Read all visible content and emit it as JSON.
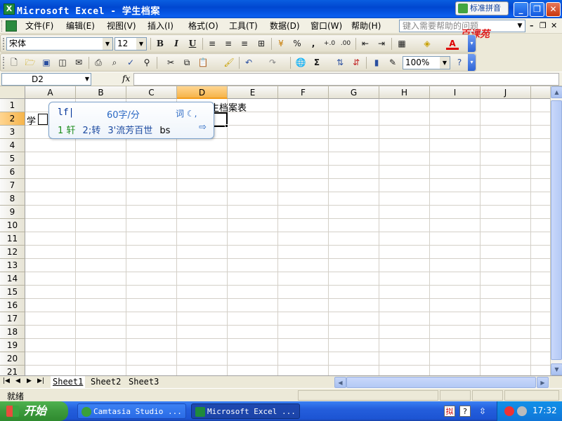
{
  "window": {
    "title": "Microsoft Excel - 学生档案",
    "ime_badge": "标准拼音",
    "minimize": "_",
    "restore": "❐",
    "close": "✕"
  },
  "menubar": {
    "items": [
      "文件(F)",
      "编辑(E)",
      "视图(V)",
      "插入(I)",
      "格式(O)",
      "工具(T)",
      "数据(D)",
      "窗口(W)",
      "帮助(H)"
    ],
    "help_placeholder": "键入需要帮助的问题",
    "watermark": "百课苑"
  },
  "format_toolbar": {
    "font": "宋体",
    "size": "12",
    "bold": "B",
    "italic": "I",
    "underline": "U",
    "percent": "%",
    "comma": ",",
    "font_color_letter": "A"
  },
  "standard_toolbar": {
    "zoom": "100%",
    "sigma": "Σ"
  },
  "formula_bar": {
    "name_box": "D2",
    "fx": "fx",
    "formula": ""
  },
  "grid": {
    "columns": [
      "A",
      "B",
      "C",
      "D",
      "E",
      "F",
      "G",
      "H",
      "I",
      "J"
    ],
    "active_column": "D",
    "rows": [
      "1",
      "2",
      "3",
      "4",
      "5",
      "6",
      "7",
      "8",
      "9",
      "10",
      "11",
      "12",
      "13",
      "14",
      "15",
      "16",
      "17",
      "18",
      "19",
      "20",
      "21"
    ],
    "active_row": "2",
    "cells": {
      "D1": "学生档案表",
      "A2": "学"
    }
  },
  "ime_popup": {
    "input": "lf|",
    "speed": "60字/分",
    "word_label": "词",
    "candidates": [
      "1 轩",
      "2;转",
      "3'流芳百世"
    ],
    "tail": "bs",
    "next_arrow": "⇨"
  },
  "sheet_tabs": {
    "tabs": [
      "Sheet1",
      "Sheet2",
      "Sheet3"
    ],
    "active": "Sheet1"
  },
  "status": {
    "text": "就绪"
  },
  "taskbar": {
    "start": "开始",
    "tasks": [
      "Camtasia Studio ...",
      "Microsoft Excel ..."
    ],
    "clock": "17:32"
  },
  "colors": {
    "titlebar": "#0a5ee0",
    "active_header": "#f6b44a",
    "taskbar": "#245edc",
    "start_green": "#3c9a3c"
  }
}
